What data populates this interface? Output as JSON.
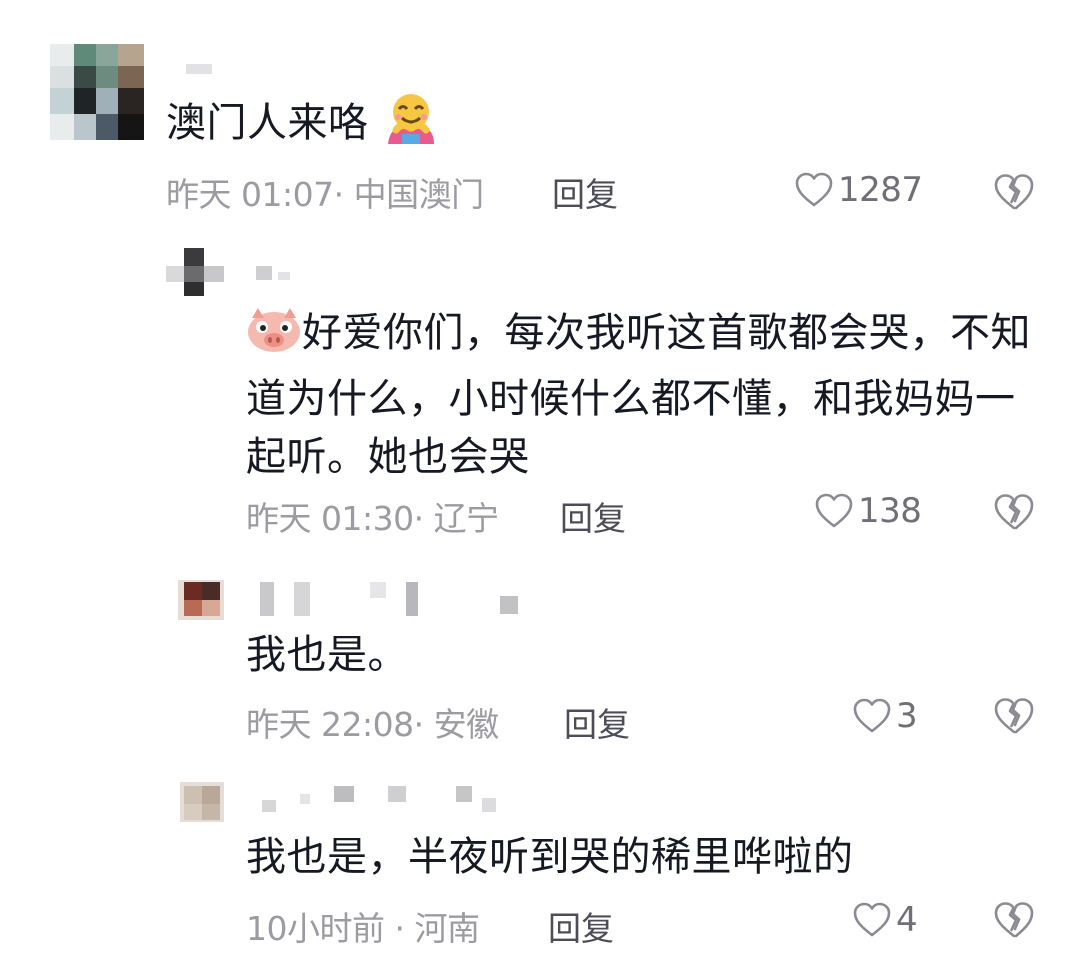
{
  "comments": [
    {
      "text": "澳门人来咯",
      "emoji": "hug-emoji",
      "time": "昨天 01:07",
      "location": "中国澳门",
      "reply_label": "回复",
      "likes": "1287"
    },
    {
      "text": "好爱你们，每次我听这首歌都会哭，不知道为什么，小时候什么都不懂，和我妈妈一起听。她也会哭",
      "emoji": "pig-emoji",
      "time": "昨天 01:30",
      "location": "辽宁",
      "reply_label": "回复",
      "likes": "138"
    },
    {
      "text": "我也是。",
      "time": "昨天 22:08",
      "location": "安徽",
      "reply_label": "回复",
      "likes": "3"
    },
    {
      "text": "我也是，半夜听到哭的稀里哗啦的",
      "time": "10小时前",
      "location": "河南",
      "reply_label": "回复",
      "likes": "4"
    }
  ],
  "meta_separator": "·",
  "icons": {
    "like": "heart-outline-icon",
    "dislike": "broken-heart-icon"
  },
  "colors": {
    "text": "#161823",
    "meta": "#9b9ba1",
    "reply": "#4d4d57"
  }
}
